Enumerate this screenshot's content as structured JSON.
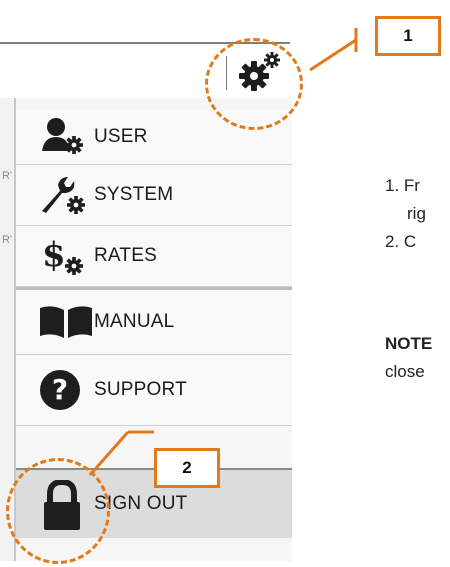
{
  "callouts": [
    "1",
    "2"
  ],
  "menu": {
    "items": [
      {
        "label": "USER",
        "icon": "user-settings-icon"
      },
      {
        "label": "SYSTEM",
        "icon": "wrench-settings-icon"
      },
      {
        "label": "RATES",
        "icon": "dollar-settings-icon"
      },
      {
        "label": "MANUAL",
        "icon": "book-icon"
      },
      {
        "label": "SUPPORT",
        "icon": "question-icon"
      },
      {
        "label": "SIGN OUT",
        "icon": "lock-icon"
      }
    ]
  },
  "header": {
    "settings_icon": "gear-icon"
  },
  "instructions": {
    "steps": [
      "1. Fr",
      "rig",
      "2. C"
    ],
    "note_bold": "NOTE",
    "note_text": "close"
  },
  "side_cut": {
    "fragments": [
      "R'",
      "R'"
    ]
  },
  "colors": {
    "accent": "#e07a1a",
    "menu_bg": "#f6f6f6",
    "signout_bg": "#dcdcdc"
  }
}
